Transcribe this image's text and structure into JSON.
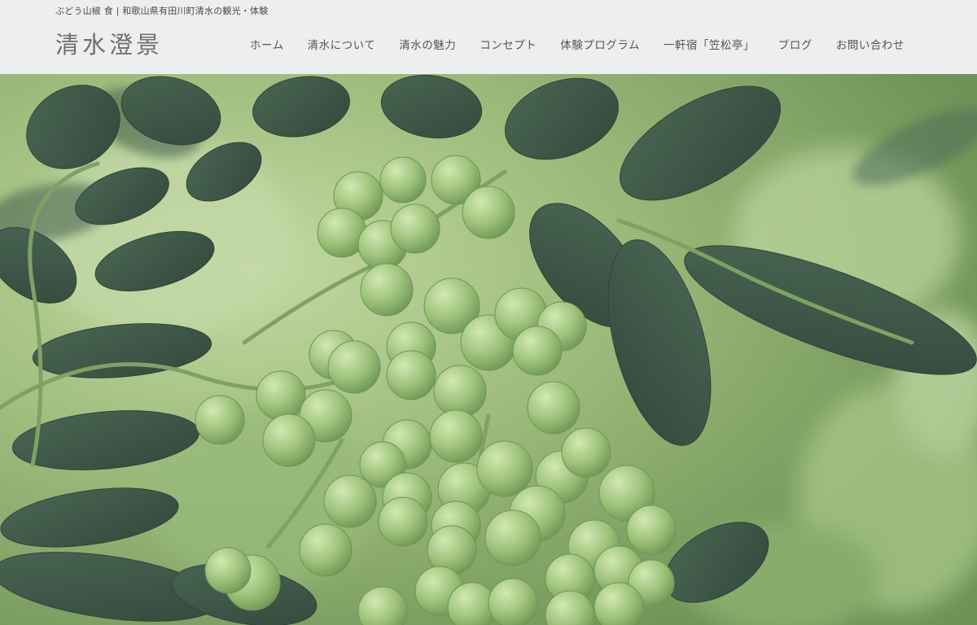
{
  "header": {
    "tagline": "ぶどう山椒 食 | 和歌山県有田川町清水の観光・体験",
    "site_title": "清水澄景"
  },
  "nav": {
    "items": [
      {
        "label": "ホーム"
      },
      {
        "label": "清水について"
      },
      {
        "label": "清水の魅力"
      },
      {
        "label": "コンセプト"
      },
      {
        "label": "体験プログラム"
      },
      {
        "label": "一軒宿「笠松亭」"
      },
      {
        "label": "ブログ"
      },
      {
        "label": "お問い合わせ"
      }
    ]
  },
  "colors": {
    "header_bg": "#eceeef",
    "foliage_dark": "#3f5a48",
    "berry": "#9cc47a"
  }
}
